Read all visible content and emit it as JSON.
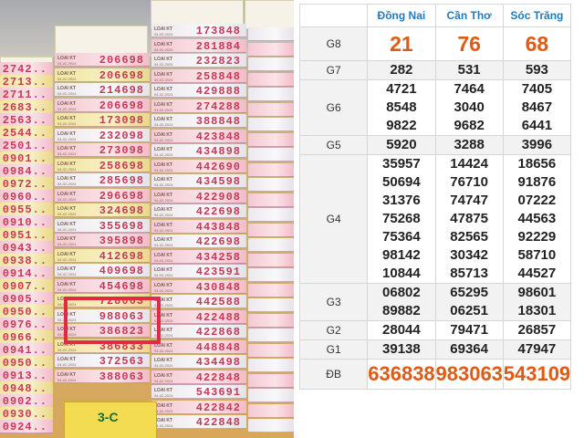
{
  "photo": {
    "columns": [
      {
        "tickets": [
          "2742..",
          "2713..",
          "2711..",
          "2683..",
          "2563..",
          "2544..",
          "2501..",
          "0901..",
          "0984..",
          "0972..",
          "0960..",
          "0955..",
          "0910..",
          "0951..",
          "0943..",
          "0938..",
          "0914..",
          "0907..",
          "0905..",
          "0950..",
          "0976..",
          "0966..",
          "0941..",
          "0950..",
          "0913..",
          "0948..",
          "0902..",
          "0930..",
          "0924.."
        ]
      },
      {
        "tickets": [
          "206698",
          "206698",
          "214698",
          "206698",
          "173098",
          "232098",
          "273098",
          "258698",
          "285698",
          "296698",
          "324698",
          "355698",
          "395898",
          "412698",
          "409698",
          "454698",
          "728063",
          "988063",
          "386823",
          "386833",
          "372563",
          "388063"
        ]
      },
      {
        "tickets": [
          "173848",
          "281884",
          "232823",
          "258848",
          "429888",
          "274288",
          "388848",
          "423848",
          "434898",
          "442690",
          "434598",
          "422908",
          "422698",
          "443848",
          "422698",
          "434258",
          "423591",
          "430848",
          "442588",
          "422488",
          "422868",
          "448848",
          "434498",
          "422848",
          "543691",
          "422842",
          "422848"
        ]
      }
    ],
    "highlight_numbers": [
      "728063",
      "988063"
    ]
  },
  "table": {
    "headers": [
      "Đồng Nai",
      "Cần Thơ",
      "Sóc Trăng"
    ],
    "rows": [
      {
        "prize": "G8",
        "values": [
          [
            "21"
          ],
          [
            "76"
          ],
          [
            "68"
          ]
        ]
      },
      {
        "prize": "G7",
        "values": [
          [
            "282"
          ],
          [
            "531"
          ],
          [
            "593"
          ]
        ]
      },
      {
        "prize": "G6",
        "values": [
          [
            "4721",
            "8548",
            "9822"
          ],
          [
            "7464",
            "3040",
            "9682"
          ],
          [
            "7405",
            "8467",
            "6441"
          ]
        ]
      },
      {
        "prize": "G5",
        "values": [
          [
            "5920"
          ],
          [
            "3288"
          ],
          [
            "3996"
          ]
        ]
      },
      {
        "prize": "G4",
        "values": [
          [
            "35957",
            "50694",
            "31376",
            "75268",
            "75364",
            "98142",
            "10844"
          ],
          [
            "14424",
            "76710",
            "74747",
            "47875",
            "82565",
            "30342",
            "85713"
          ],
          [
            "18656",
            "91876",
            "07222",
            "44563",
            "92229",
            "58710",
            "44527"
          ]
        ]
      },
      {
        "prize": "G3",
        "values": [
          [
            "06802",
            "89882"
          ],
          [
            "65295",
            "06251"
          ],
          [
            "98601",
            "18301"
          ]
        ]
      },
      {
        "prize": "G2",
        "values": [
          [
            "28044"
          ],
          [
            "79471"
          ],
          [
            "26857"
          ]
        ]
      },
      {
        "prize": "G1",
        "values": [
          [
            "39138"
          ],
          [
            "69364"
          ],
          [
            "47947"
          ]
        ]
      },
      {
        "prize": "ĐB",
        "values": [
          [
            "636838"
          ],
          [
            "983063"
          ],
          [
            "543109"
          ]
        ]
      }
    ]
  },
  "colors": {
    "header_text": "#1f7ac0",
    "big_number": "#e05a14",
    "highlight_box": "#e02b43",
    "ticket_number": "#c23c5a"
  }
}
